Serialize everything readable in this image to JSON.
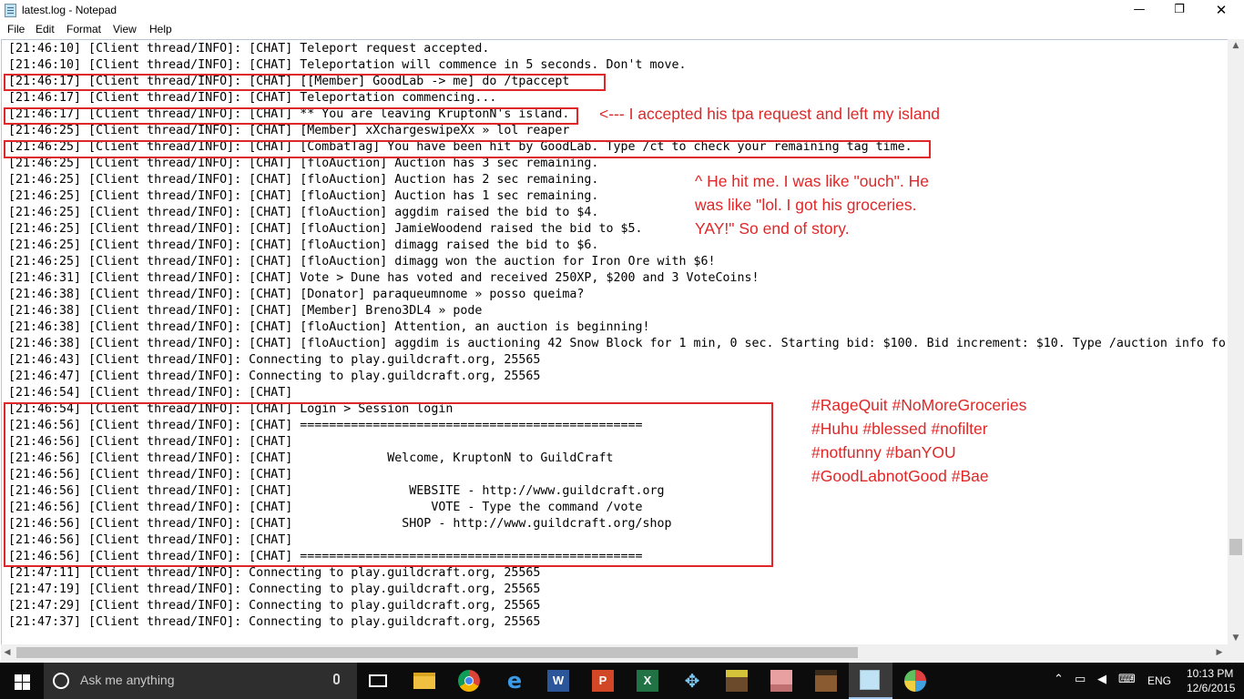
{
  "window": {
    "title": "latest.log - Notepad",
    "min_glyph": "—",
    "max_glyph": "❐",
    "close_glyph": "✕"
  },
  "menu": [
    "File",
    "Edit",
    "Format",
    "View",
    "Help"
  ],
  "log_lines": [
    "[21:46:10] [Client thread/INFO]: [CHAT] Teleport request accepted.",
    "[21:46:10] [Client thread/INFO]: [CHAT] Teleportation will commence in 5 seconds. Don't move.",
    "[21:46:17] [Client thread/INFO]: [CHAT] [[Member] GoodLab -> me] do /tpaccept",
    "[21:46:17] [Client thread/INFO]: [CHAT] Teleportation commencing...",
    "[21:46:17] [Client thread/INFO]: [CHAT] ** You are leaving KruptonN's island.",
    "[21:46:25] [Client thread/INFO]: [CHAT] [Member] xXchargeswipeXx » lol reaper",
    "[21:46:25] [Client thread/INFO]: [CHAT] [CombatTag] You have been hit by GoodLab. Type /ct to check your remaining tag time.",
    "[21:46:25] [Client thread/INFO]: [CHAT] [floAuction] Auction has 3 sec remaining.",
    "[21:46:25] [Client thread/INFO]: [CHAT] [floAuction] Auction has 2 sec remaining.",
    "[21:46:25] [Client thread/INFO]: [CHAT] [floAuction] Auction has 1 sec remaining.",
    "[21:46:25] [Client thread/INFO]: [CHAT] [floAuction] aggdim raised the bid to $4.",
    "[21:46:25] [Client thread/INFO]: [CHAT] [floAuction] JamieWoodend raised the bid to $5.",
    "[21:46:25] [Client thread/INFO]: [CHAT] [floAuction] dimagg raised the bid to $6.",
    "[21:46:25] [Client thread/INFO]: [CHAT] [floAuction] dimagg won the auction for Iron Ore with $6!",
    "[21:46:31] [Client thread/INFO]: [CHAT] Vote > Dune has voted and received 250XP, $200 and 3 VoteCoins!",
    "[21:46:38] [Client thread/INFO]: [CHAT] [Donator] paraqueumnome » posso queima?",
    "[21:46:38] [Client thread/INFO]: [CHAT] [Member] Breno3DL4 » pode",
    "[21:46:38] [Client thread/INFO]: [CHAT] [floAuction] Attention, an auction is beginning!",
    "[21:46:38] [Client thread/INFO]: [CHAT] [floAuction] aggdim is auctioning 42 Snow Block for 1 min, 0 sec. Starting bid: $100. Bid increment: $10. Type /auction info fo",
    "[21:46:43] [Client thread/INFO]: Connecting to play.guildcraft.org, 25565",
    "[21:46:47] [Client thread/INFO]: Connecting to play.guildcraft.org, 25565",
    "[21:46:54] [Client thread/INFO]: [CHAT]",
    "[21:46:54] [Client thread/INFO]: [CHAT] Login > Session login",
    "[21:46:56] [Client thread/INFO]: [CHAT] ===============================================",
    "[21:46:56] [Client thread/INFO]: [CHAT]",
    "[21:46:56] [Client thread/INFO]: [CHAT]             Welcome, KruptonN to GuildCraft",
    "[21:46:56] [Client thread/INFO]: [CHAT]",
    "[21:46:56] [Client thread/INFO]: [CHAT]                WEBSITE - http://www.guildcraft.org",
    "[21:46:56] [Client thread/INFO]: [CHAT]                   VOTE - Type the command /vote",
    "[21:46:56] [Client thread/INFO]: [CHAT]               SHOP - http://www.guildcraft.org/shop",
    "[21:46:56] [Client thread/INFO]: [CHAT]",
    "[21:46:56] [Client thread/INFO]: [CHAT] ===============================================",
    "[21:47:11] [Client thread/INFO]: Connecting to play.guildcraft.org, 25565",
    "[21:47:19] [Client thread/INFO]: Connecting to play.guildcraft.org, 25565",
    "[21:47:29] [Client thread/INFO]: Connecting to play.guildcraft.org, 25565",
    "[21:47:37] [Client thread/INFO]: Connecting to play.guildcraft.org, 25565"
  ],
  "annotations": {
    "note_tpa": "<--- I accepted his tpa request and left my island",
    "note_hit": [
      "^ He hit me. I was like \"ouch\". He",
      "was like \"lol. I got his groceries.",
      "YAY!\" So end of story."
    ],
    "note_tags": [
      "#RageQuit #NoMoreGroceries",
      "#Huhu #blessed #nofilter",
      "#notfunny #banYOU",
      "#GoodLabnotGood #Bae"
    ],
    "color": "#e02727"
  },
  "taskbar": {
    "search_placeholder": "Ask me anything",
    "language": "ENG",
    "time": "10:13 PM",
    "date": "12/6/2015",
    "apps": [
      "task-view-icon",
      "file-explorer-icon",
      "chrome-icon",
      "edge-icon",
      "word-icon",
      "powerpoint-icon",
      "excel-icon",
      "game-controller-icon",
      "minecraft-grass-icon",
      "minecraft-pig-icon",
      "minecraft-crafting-icon",
      "notepad-icon",
      "paint-icon"
    ]
  }
}
